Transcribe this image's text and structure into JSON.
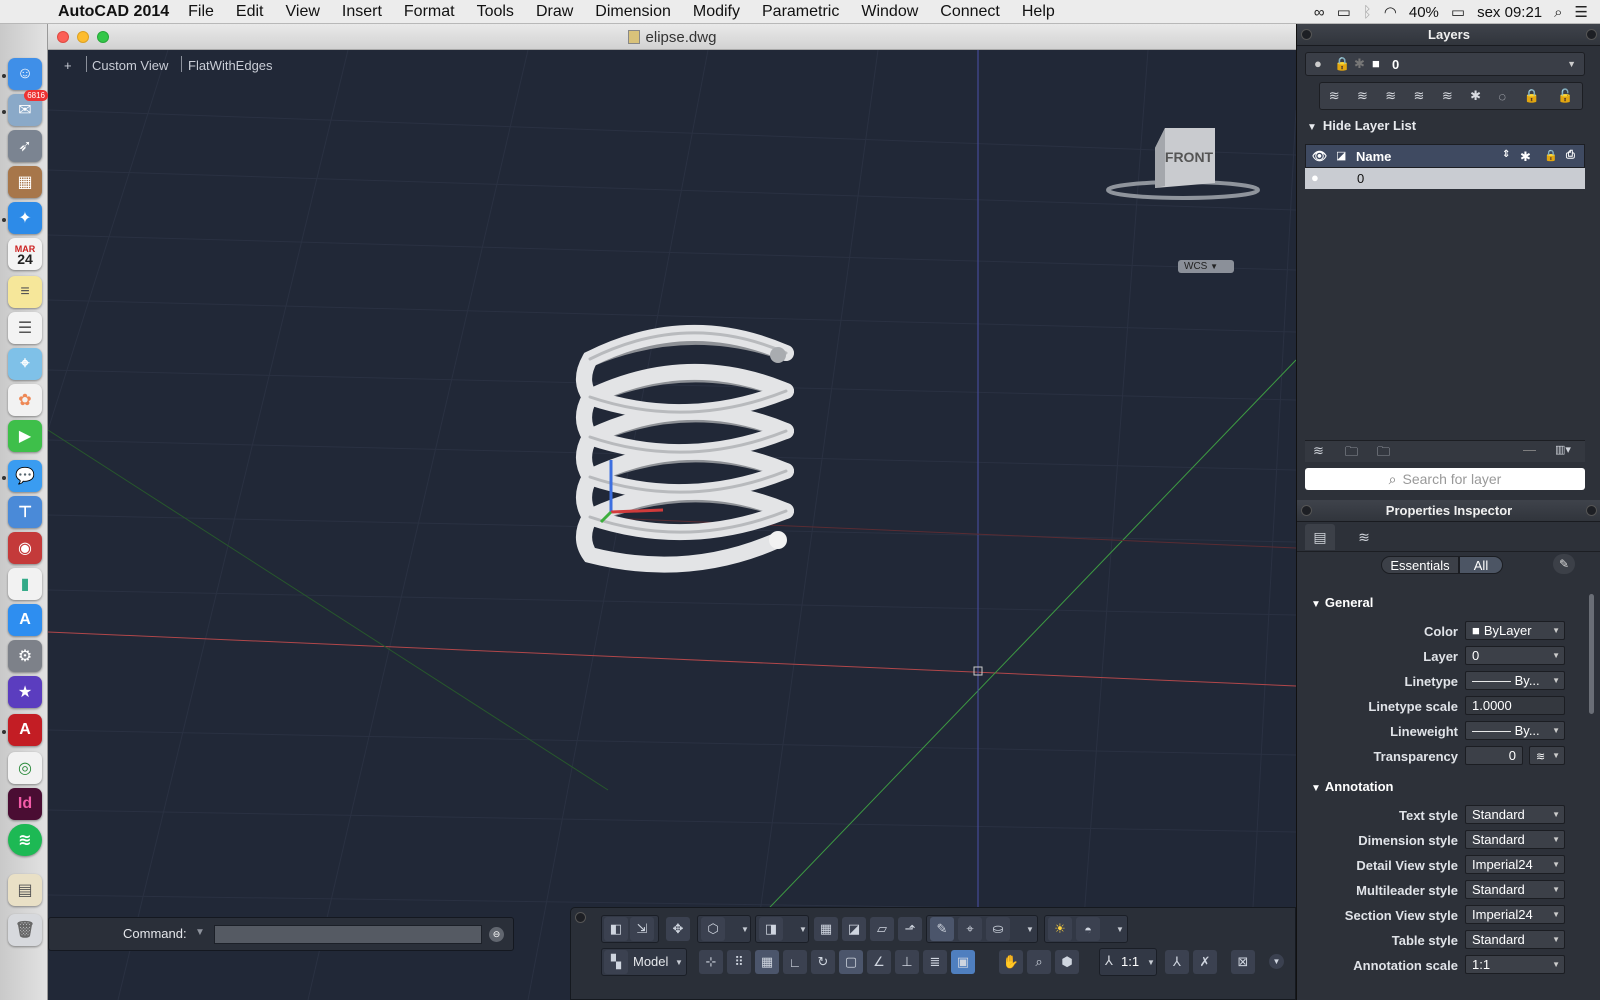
{
  "menubar": {
    "app_name": "AutoCAD 2014",
    "items": [
      "File",
      "Edit",
      "View",
      "Insert",
      "Format",
      "Tools",
      "Draw",
      "Dimension",
      "Modify",
      "Parametric",
      "Window",
      "Connect",
      "Help"
    ],
    "battery": "40%",
    "clock": "sex 09:21"
  },
  "dock": {
    "mail_badge": "6816",
    "calendar_month": "MAR",
    "calendar_day": "24",
    "indesign_label": "Id"
  },
  "window": {
    "title": "elipse.dwg"
  },
  "viewport": {
    "plus": "+",
    "view_name": "Custom View",
    "visual_style": "FlatWithEdges",
    "viewcube_face": "FRONT",
    "wcs_label": "WCS"
  },
  "command": {
    "label": "Command:",
    "value": ""
  },
  "statusbar": {
    "model_label": "Model",
    "annotation_scale": "1:1"
  },
  "layers_panel": {
    "title": "Layers",
    "current_layer": "0",
    "hide_list_label": "Hide Layer List",
    "column_name": "Name",
    "rows": [
      {
        "name": "0"
      }
    ],
    "search_placeholder": "Search for layer"
  },
  "properties_panel": {
    "title": "Properties Inspector",
    "tab_essentials": "Essentials",
    "tab_all": "All",
    "general": {
      "title": "General",
      "props": [
        {
          "label": "Color",
          "value": "ByLayer"
        },
        {
          "label": "Layer",
          "value": "0"
        },
        {
          "label": "Linetype",
          "value": "——— By..."
        },
        {
          "label": "Linetype scale",
          "value": "1.0000"
        },
        {
          "label": "Lineweight",
          "value": "——— By..."
        },
        {
          "label": "Transparency",
          "value": "0"
        }
      ]
    },
    "annotation": {
      "title": "Annotation",
      "props": [
        {
          "label": "Text style",
          "value": "Standard"
        },
        {
          "label": "Dimension style",
          "value": "Standard"
        },
        {
          "label": "Detail View style",
          "value": "Imperial24"
        },
        {
          "label": "Multileader style",
          "value": "Standard"
        },
        {
          "label": "Section View style",
          "value": "Imperial24"
        },
        {
          "label": "Table style",
          "value": "Standard"
        },
        {
          "label": "Annotation scale",
          "value": "1:1"
        }
      ]
    }
  }
}
